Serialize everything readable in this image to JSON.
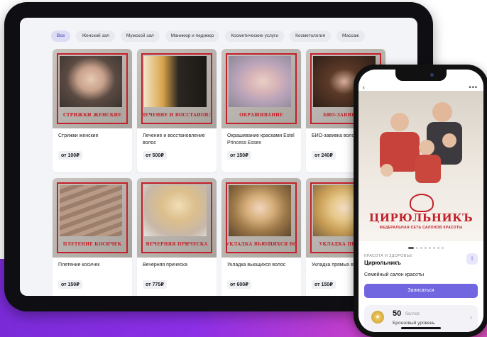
{
  "tablet": {
    "categories": [
      {
        "label": "Все",
        "active": true
      },
      {
        "label": "Женский зал",
        "active": false
      },
      {
        "label": "Мужской зал",
        "active": false
      },
      {
        "label": "Маникюр и педикюр",
        "active": false
      },
      {
        "label": "Косметические услуги",
        "active": false
      },
      {
        "label": "Косметология",
        "active": false
      },
      {
        "label": "Массаж",
        "active": false
      }
    ],
    "services": [
      {
        "ribbon": "СТРИЖКИ ЖЕНСКИЕ",
        "title": "Стрижки женские",
        "price": "от 100₽"
      },
      {
        "ribbon": "ЛЕЧЕНИЕ И ВОССТАНОВЛЕНИЕ",
        "title": "Лечение и восстановление волос",
        "price": "от 500₽"
      },
      {
        "ribbon": "ОКРАШИВАНИЕ",
        "title": "Окрашивание красками Estel Princess Essex",
        "price": "от 150₽"
      },
      {
        "ribbon": "БИО-ЗАВИВКА В",
        "title": "БИО-завивка волос",
        "price": "от 240₽"
      },
      {
        "ribbon": "ПЛЕТЕНИЕ КОСИЧЕК",
        "title": "Плетение косичек",
        "price": "от 150₽"
      },
      {
        "ribbon": "ВЕЧЕРНЯЯ ПРИЧЕСКА",
        "title": "Вечерняя прическа",
        "price": "от 775₽"
      },
      {
        "ribbon": "УКЛАДКА ВЬЮЩИХСЯ ВОЛОС",
        "title": "Укладка вьющихся волос",
        "price": "от 600₽"
      },
      {
        "ribbon": "УКЛАДКА ПРЯМЫХ",
        "title": "Укладка прямых вол",
        "price": "от 150₽"
      }
    ]
  },
  "phone": {
    "back_glyph": "‹",
    "menu_glyph": "•••",
    "logo_text": "ЦИРЮЛЬНИКЪ",
    "logo_subtitle": "ФЕДЕРАЛЬНАЯ СЕТЬ САЛОНОВ КРАСОТЫ",
    "category": "КРАСОТА И ЗДОРОВЬЕ",
    "salon_name": "Цирюльникъ",
    "info_glyph": "i",
    "description": "Семейный салон красоты",
    "book_label": "Записаться",
    "loyalty": {
      "points": "50",
      "points_unit": "баллов",
      "level": "Бронзовый уровень",
      "medal_glyph": "★",
      "chevron": "›"
    }
  },
  "colors": {
    "accent": "#7166e0",
    "brand_red": "#c2202a",
    "background_band": "#8c2fe6"
  }
}
